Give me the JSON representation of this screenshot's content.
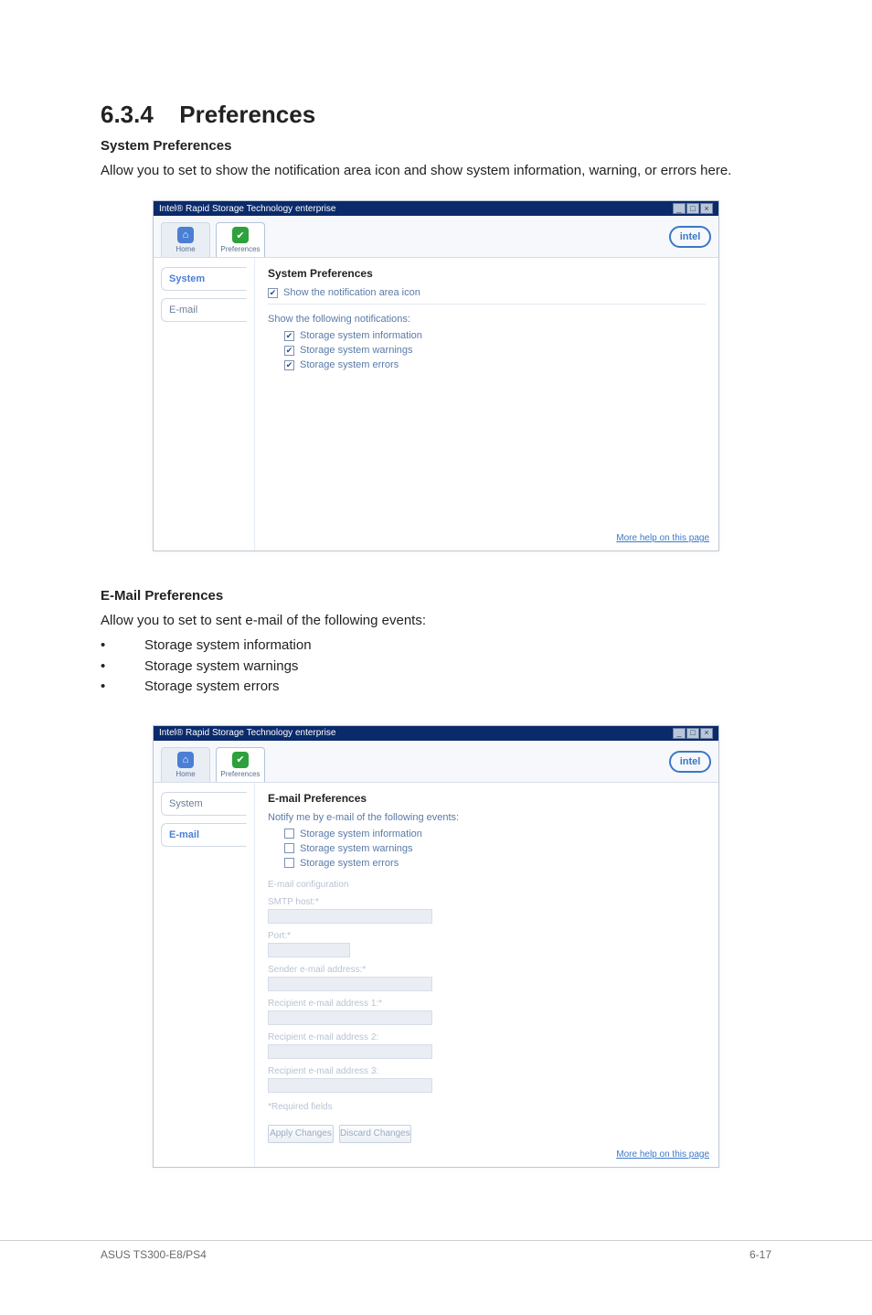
{
  "doc": {
    "section_number": "6.3.4",
    "section_title": "Preferences",
    "system_preferences_heading": "System Preferences",
    "system_preferences_para": "Allow you to set to show the notification area icon and show system information, warning, or errors here.",
    "email_preferences_heading": "E-Mail Preferences",
    "email_preferences_para": "Allow you to set to sent e-mail of the following events:",
    "bullet_1": "Storage system information",
    "bullet_2": "Storage system warnings",
    "bullet_3": "Storage system errors",
    "footer_left": "ASUS TS300-E8/PS4",
    "footer_right": "6-17"
  },
  "ui": {
    "titlebar_text": "Intel® Rapid Storage Technology enterprise",
    "logo_text": "intel",
    "tab_home": "Home",
    "tab_prefs": "Preferences",
    "sidebar_system": "System",
    "sidebar_email": "E-mail",
    "more_help": "More help on this page"
  },
  "sysprefs": {
    "panel_title": "System Preferences",
    "show_icon": "Show the notification area icon",
    "show_following": "Show the following notifications:",
    "opt_info": "Storage system information",
    "opt_warn": "Storage system warnings",
    "opt_err": "Storage system errors"
  },
  "emailprefs": {
    "panel_title": "E-mail Preferences",
    "notify_text": "Notify me by e-mail of the following events:",
    "opt_info": "Storage system information",
    "opt_warn": "Storage system warnings",
    "opt_err": "Storage system errors",
    "config_head": "E-mail configuration",
    "smtp_label": "SMTP host:*",
    "port_label": "Port:*",
    "sender_label": "Sender e-mail address:*",
    "rcpt1_label": "Recipient e-mail address 1:*",
    "rcpt2_label": "Recipient e-mail address 2:",
    "rcpt3_label": "Recipient e-mail address 3:",
    "req_label": "*Required fields",
    "btn_apply": "Apply Changes",
    "btn_discard": "Discard Changes"
  }
}
